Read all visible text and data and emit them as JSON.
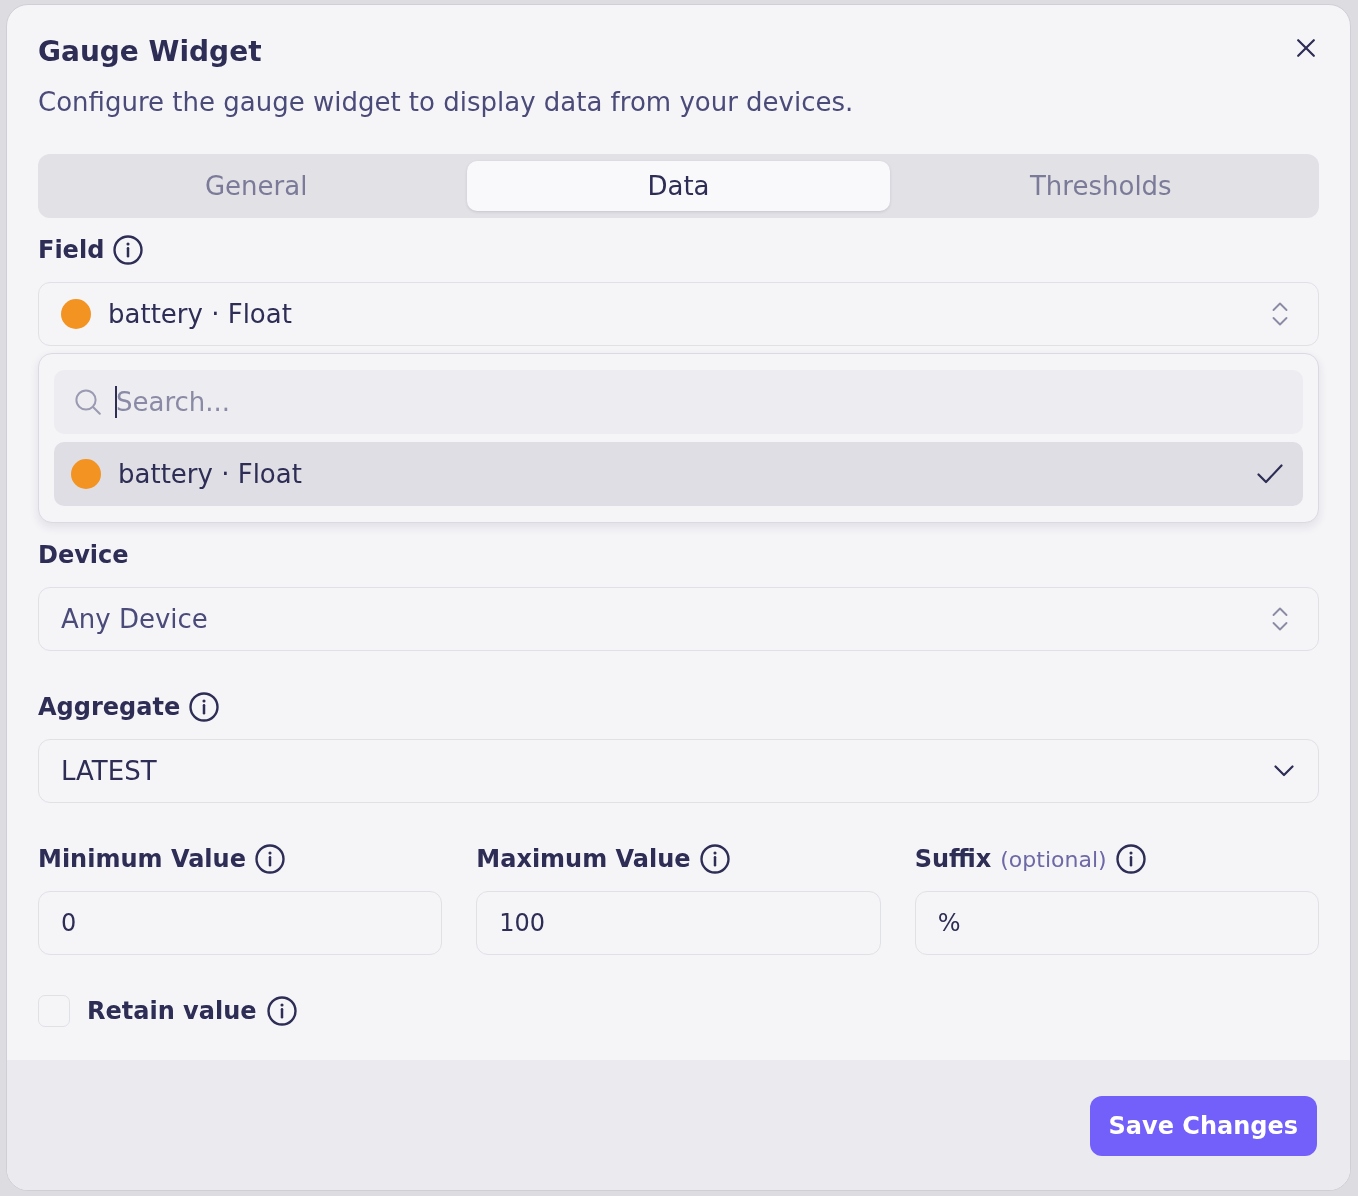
{
  "dialog": {
    "title": "Gauge Widget",
    "description": "Configure the gauge widget to display data from your devices."
  },
  "tabs": [
    {
      "label": "General",
      "selected": false
    },
    {
      "label": "Data",
      "selected": true
    },
    {
      "label": "Thresholds",
      "selected": false
    }
  ],
  "field": {
    "label": "Field",
    "info_icon": true,
    "kind": "combobox",
    "value": "battery · Float",
    "color": "#f39322",
    "expanded": true,
    "search": {
      "placeholder": "Search...",
      "focused": true
    },
    "options": [
      {
        "label": "battery · Float",
        "color": "#f39322",
        "selected": true
      }
    ]
  },
  "device": {
    "label": "Device",
    "info_icon": false,
    "kind": "combobox",
    "placeholder": "Any Device"
  },
  "aggregate": {
    "label": "Aggregate",
    "info_icon": true,
    "kind": "select",
    "value": "LATEST"
  },
  "limits": [
    {
      "label": "Minimum Value",
      "info_icon": true,
      "value": "0"
    },
    {
      "label": "Maximum Value",
      "info_icon": true,
      "value": "100"
    },
    {
      "label": "Suffix",
      "hint": "(optional)",
      "info_icon": true,
      "value": "%"
    }
  ],
  "retain": {
    "label": "Retain value",
    "info_icon": true,
    "checked": false
  },
  "footer": {
    "save_button": "Save Changes"
  }
}
